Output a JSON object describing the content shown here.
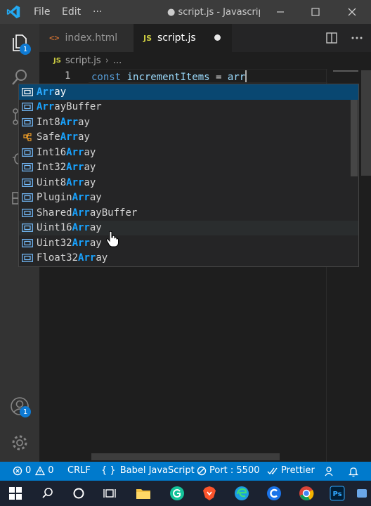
{
  "titlebar": {
    "menu": [
      "File",
      "Edit",
      "···"
    ],
    "title": "● script.js - Javascrip..."
  },
  "activity": {
    "explorer_badge": "1",
    "accounts_badge": "1"
  },
  "tabs": [
    {
      "label": "index.html",
      "icon": "html-icon",
      "active": false
    },
    {
      "label": "script.js",
      "icon": "js-icon",
      "active": true,
      "dirty": true
    }
  ],
  "tab_icons": {
    "html": "<>",
    "js": "JS"
  },
  "breadcrumb": {
    "file": "script.js",
    "symbol": "..."
  },
  "editor": {
    "line_number": "1",
    "code": {
      "keyword": "const",
      "name": " incrementItems",
      "op": " = ",
      "typed": "arr"
    }
  },
  "suggestions": [
    {
      "pre": "",
      "hl": "Arr",
      "post": "ay",
      "selected": true
    },
    {
      "pre": "",
      "hl": "Arr",
      "post": "ayBuffer"
    },
    {
      "pre": "Int8",
      "hl": "Arr",
      "post": "ay"
    },
    {
      "pre": "Safe",
      "hl": "Arr",
      "post": "ay",
      "kind": "class"
    },
    {
      "pre": "Int16",
      "hl": "Arr",
      "post": "ay"
    },
    {
      "pre": "Int32",
      "hl": "Arr",
      "post": "ay"
    },
    {
      "pre": "Uint8",
      "hl": "Arr",
      "post": "ay"
    },
    {
      "pre": "Plugin",
      "hl": "Arr",
      "post": "ay"
    },
    {
      "pre": "Shared",
      "hl": "Arr",
      "post": "ayBuffer"
    },
    {
      "pre": "Uint16",
      "hl": "Arr",
      "post": "ay",
      "hover": true
    },
    {
      "pre": "Uint32",
      "hl": "Arr",
      "post": "ay"
    },
    {
      "pre": "Float32",
      "hl": "Arr",
      "post": "ay"
    }
  ],
  "statusbar": {
    "errors": "0",
    "warnings": "0",
    "eol": "CRLF",
    "language": "Babel JavaScript",
    "port": "Port : 5500",
    "prettier": "Prettier"
  },
  "colors": {
    "accent": "#007acc",
    "selection": "#094771",
    "match_highlight": "#18a3ff"
  }
}
